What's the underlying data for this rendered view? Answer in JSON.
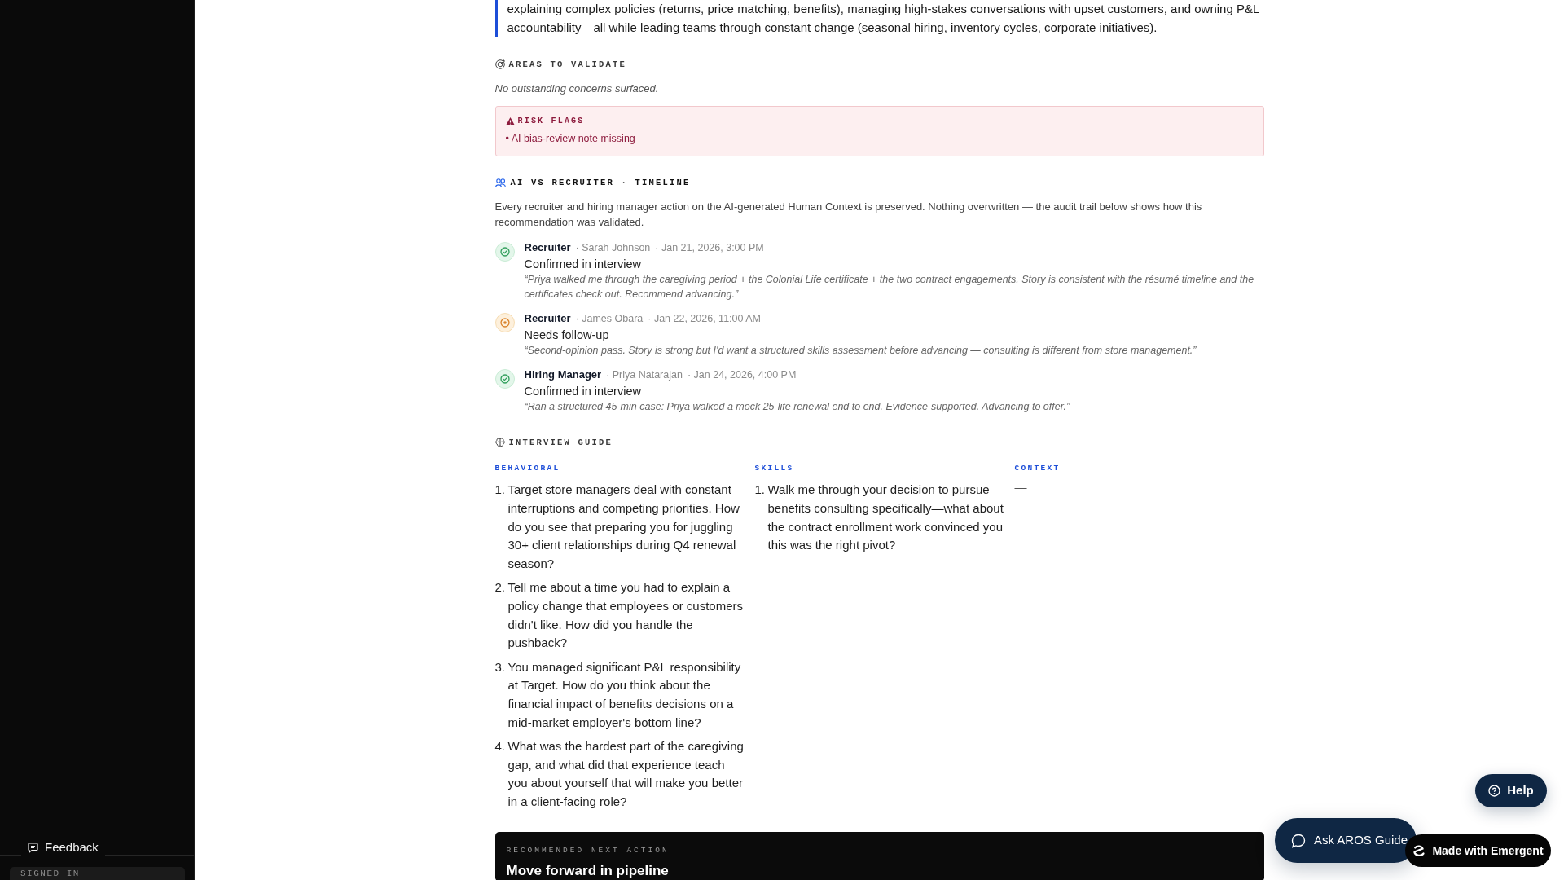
{
  "summary": {
    "text": "explaining complex policies (returns, price matching, benefits), managing high-stakes conversations with upset customers, and owning P&L accountability—all while leading teams through constant change (seasonal hiring, inventory cycles, corporate initiatives)."
  },
  "areas_to_validate": {
    "heading": "AREAS TO VALIDATE",
    "note": "No outstanding concerns surfaced."
  },
  "risk_flags": {
    "heading": "RISK FLAGS",
    "items": [
      "• AI bias-review note missing"
    ]
  },
  "timeline": {
    "heading": "AI VS RECRUITER · TIMELINE",
    "description": "Every recruiter and hiring manager action on the AI-generated Human Context is preserved. Nothing overwritten — the audit trail below shows how this recommendation was validated.",
    "entries": [
      {
        "kind": "confirmed",
        "role": "Recruiter",
        "person": "· Sarah Johnson",
        "time": "· Jan 21, 2026, 3:00 PM",
        "status": "Confirmed in interview",
        "quote": "“Priya walked me through the caregiving period + the Colonial Life certificate + the two contract engagements. Story is consistent with the résumé timeline and the certificates check out. Recommend advancing.”"
      },
      {
        "kind": "follow_up",
        "role": "Recruiter",
        "person": "· James Obara",
        "time": "· Jan 22, 2026, 11:00 AM",
        "status": "Needs follow-up",
        "quote": "“Second-opinion pass. Story is strong but I'd want a structured skills assessment before advancing — consulting is different from store management.”"
      },
      {
        "kind": "confirmed",
        "role": "Hiring Manager",
        "person": "· Priya Natarajan",
        "time": "· Jan 24, 2026, 4:00 PM",
        "status": "Confirmed in interview",
        "quote": "“Ran a structured 45-min case: Priya walked a mock 25-life renewal end to end. Evidence-supported. Advancing to offer.”"
      }
    ]
  },
  "interview_guide": {
    "heading": "INTERVIEW GUIDE",
    "columns": [
      {
        "title": "BEHAVIORAL",
        "questions": [
          {
            "number": "1.",
            "text": "Target store managers deal with constant interruptions and competing priorities. How do you see that preparing you for juggling 30+ client relationships during Q4 renewal season?"
          },
          {
            "number": "2.",
            "text": "Tell me about a time you had to explain a policy change that employees or customers didn't like. How did you handle the pushback?"
          },
          {
            "number": "3.",
            "text": "You managed significant P&L responsibility at Target. How do you think about the financial impact of benefits decisions on a mid-market employer's bottom line?"
          },
          {
            "number": "4.",
            "text": "What was the hardest part of the caregiving gap, and what did that experience teach you about yourself that will make you better in a client-facing role?"
          }
        ]
      },
      {
        "title": "SKILLS",
        "questions": [
          {
            "number": "1.",
            "text": "Walk me through your decision to pursue benefits consulting specifically—what about the contract enrollment work convinced you this was the right pivot?"
          }
        ]
      },
      {
        "title": "CONTEXT",
        "empty_text": "—"
      }
    ]
  },
  "next_action": {
    "label": "RECOMMENDED NEXT ACTION",
    "title": "Move forward in pipeline"
  },
  "sidebar": {
    "feedback": "Feedback",
    "signed_in": "SIGNED IN"
  },
  "floating": {
    "help": "Help",
    "ask": "Ask AROS Guide",
    "made_with": "Made with Emergent"
  }
}
